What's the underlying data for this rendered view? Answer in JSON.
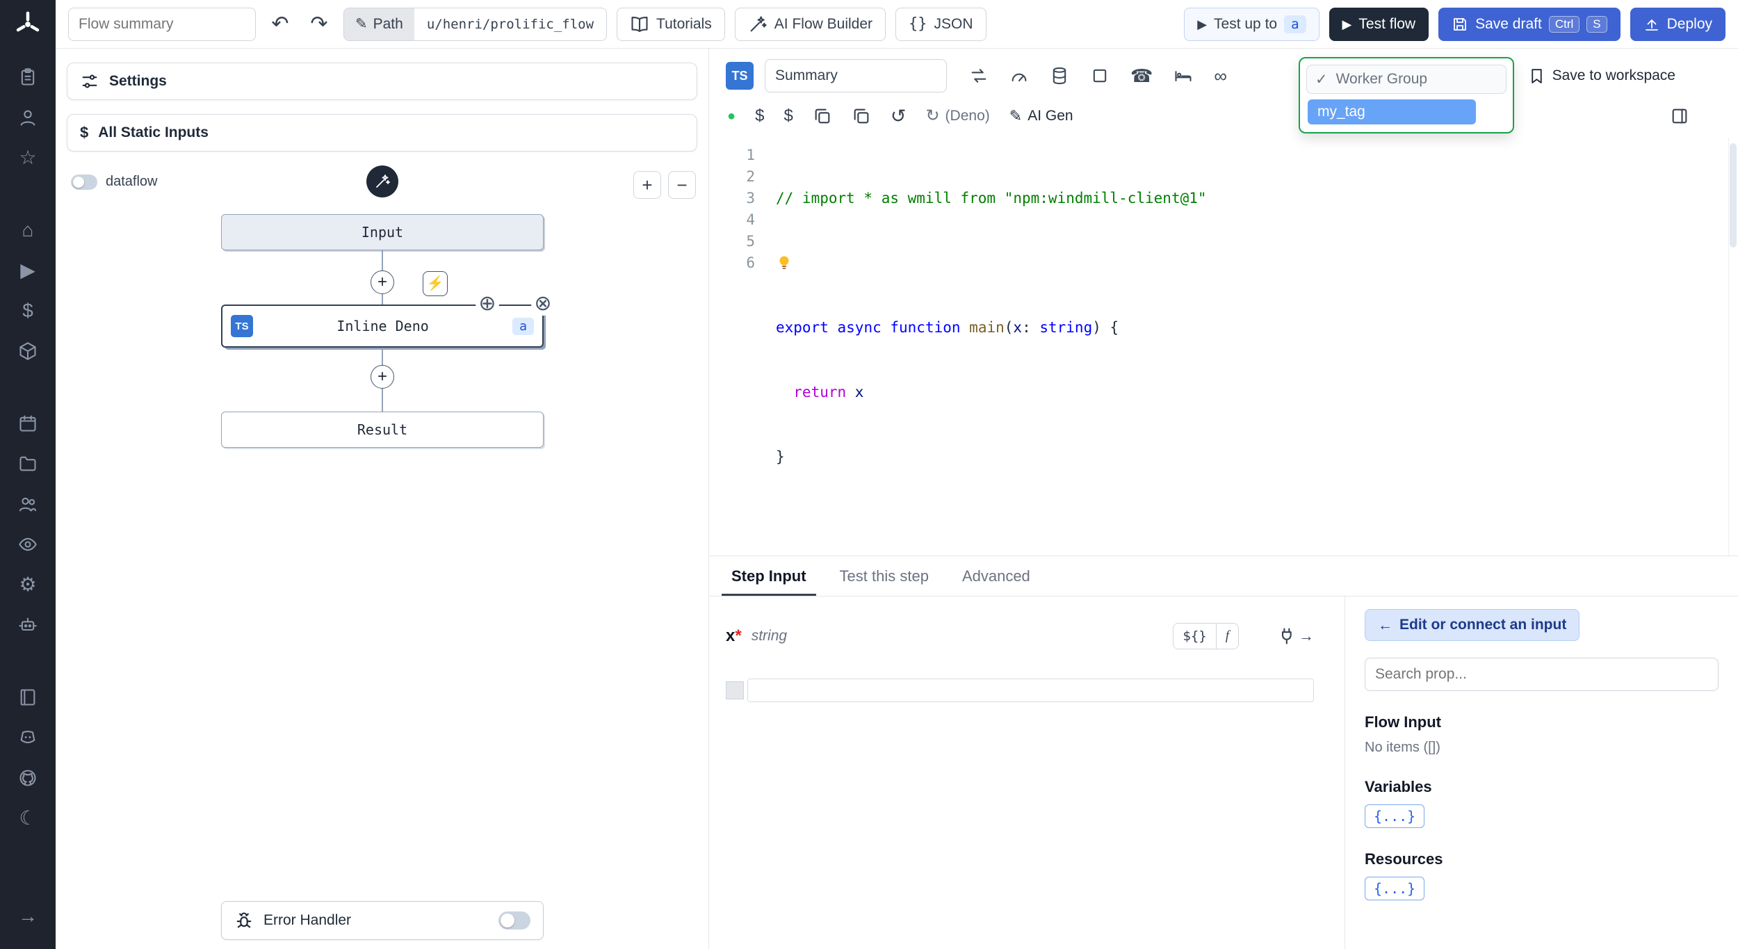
{
  "icons": {
    "undo": "↶",
    "redo": "↷",
    "pencil": "✎",
    "play": "▶",
    "check": "✓",
    "arrow_left": "←",
    "arrow_right": "→",
    "plus": "+",
    "minus": "−",
    "move": "⊕",
    "close": "⊗",
    "history": "↺",
    "refresh": "↻",
    "infinity": "∞",
    "moon": "☾",
    "gear": "⚙",
    "home": "⌂",
    "star": "☆",
    "phone": "☎",
    "bolt": "⚡",
    "dollar": "$",
    "dot": "●",
    "braces": "{}",
    "expr": "${}",
    "fn": "f"
  },
  "topbar": {
    "flow_summary_placeholder": "Flow summary",
    "path_label": "Path",
    "path_value": "u/henri/prolific_flow",
    "tutorials": "Tutorials",
    "ai_flow_builder": "AI Flow Builder",
    "json_label": "JSON",
    "test_up_to": "Test up to",
    "test_up_to_badge": "a",
    "test_flow": "Test flow",
    "save_draft": "Save draft",
    "kbd_ctrl": "Ctrl",
    "kbd_s": "S",
    "deploy": "Deploy"
  },
  "flow_panel": {
    "settings_label": "Settings",
    "static_inputs_label": "All Static Inputs",
    "dataflow_label": "dataflow",
    "input_node": "Input",
    "inline_node": "Inline Deno",
    "inline_lang": "TS",
    "inline_badge": "a",
    "result_node": "Result",
    "error_handler_label": "Error Handler"
  },
  "editor": {
    "lang_badge": "TS",
    "summary_value": "Summary",
    "save_to_workspace": "Save to workspace",
    "deno_label": "(Deno)",
    "ai_gen_label": "AI Gen",
    "dropdown": {
      "header": "Worker Group",
      "selected": "my_tag"
    }
  },
  "code": {
    "line_numbers": [
      "1",
      "2",
      "3",
      "4",
      "5",
      "6"
    ],
    "l1": "// import * as wmill from \"npm:windmill-client@1\"",
    "l3": {
      "kw1": "export ",
      "kw2": "async ",
      "kw3": "function",
      "fn": " main",
      "p1": "(",
      "var": "x",
      "colon": ": ",
      "type": "string",
      "end": ") {"
    },
    "l4": {
      "kw": "  return",
      "var": " x"
    },
    "l5": "}"
  },
  "bottom": {
    "tabs": [
      "Step Input",
      "Test this step",
      "Advanced"
    ],
    "field_name": "x",
    "required_mark": "*",
    "field_type": "string",
    "connect_label": "Edit or connect an input",
    "search_placeholder": "Search prop...",
    "flow_input_title": "Flow Input",
    "flow_input_empty": "No items ([])",
    "variables_title": "Variables",
    "variables_badge": "{...}",
    "resources_title": "Resources",
    "resources_badge": "{...}"
  }
}
